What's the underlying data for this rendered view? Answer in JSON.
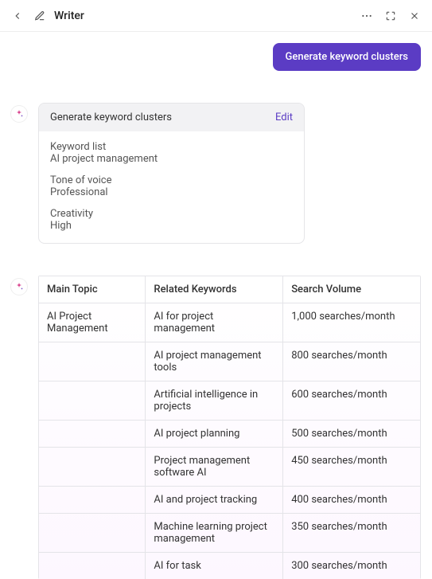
{
  "header": {
    "title": "Writer"
  },
  "chat": {
    "user_bubble": "Generate keyword clusters"
  },
  "card": {
    "title": "Generate keyword clusters",
    "edit_label": "Edit",
    "fields": {
      "keyword_list_label": "Keyword list",
      "keyword_list_value": "AI project management",
      "tone_label": "Tone of voice",
      "tone_value": "Professional",
      "creativity_label": "Creativity",
      "creativity_value": "High"
    }
  },
  "table": {
    "headers": {
      "main_topic": "Main Topic",
      "related_keywords": "Related Keywords",
      "search_volume": "Search Volume"
    },
    "rows": [
      {
        "main_topic": "AI Project Management",
        "related": "AI for project management",
        "volume": "1,000 searches/month"
      },
      {
        "main_topic": "",
        "related": "AI project manage­ment tools",
        "volume": "800 searches/month"
      },
      {
        "main_topic": "",
        "related": "Artificial intelligence in projects",
        "volume": "600 searches/month"
      },
      {
        "main_topic": "",
        "related": "AI project planning",
        "volume": "500 searches/month"
      },
      {
        "main_topic": "",
        "related": "Project management software AI",
        "volume": "450 searches/month"
      },
      {
        "main_topic": "",
        "related": "AI and project tracking",
        "volume": "400 searches/month"
      },
      {
        "main_topic": "",
        "related": "Machine learning project management",
        "volume": "350 searches/month"
      },
      {
        "main_topic": "",
        "related": "AI for task",
        "volume": "300 searches/month"
      }
    ]
  }
}
